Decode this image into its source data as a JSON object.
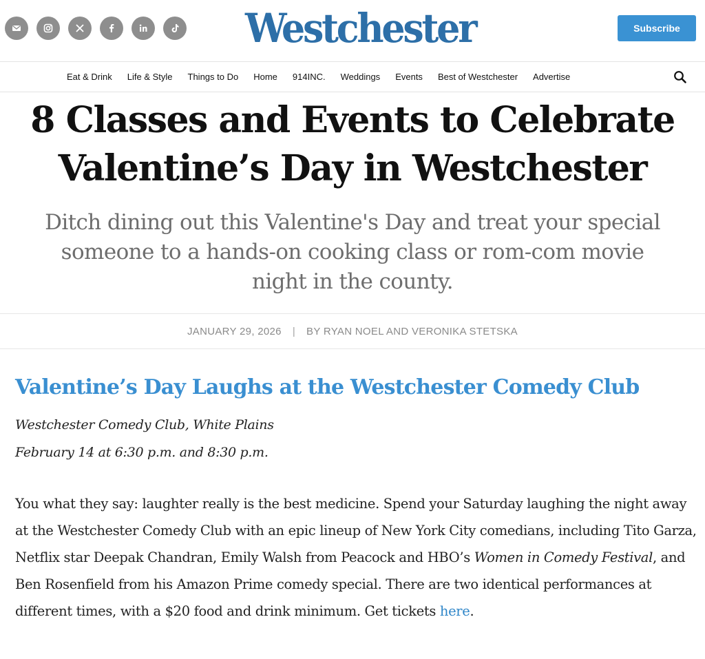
{
  "header": {
    "logo_text": "Westchester",
    "subscribe_label": "Subscribe",
    "social_icons": [
      "email-icon",
      "instagram-icon",
      "x-icon",
      "facebook-icon",
      "linkedin-icon",
      "tiktok-icon"
    ]
  },
  "nav": {
    "items": [
      "Eat & Drink",
      "Life & Style",
      "Things to Do",
      "Home",
      "914INC.",
      "Weddings",
      "Events",
      "Best of Westchester",
      "Advertise"
    ]
  },
  "article": {
    "headline_line1": "8 Classes and Events to Celebrate",
    "headline_line2": "Valentine’s Day in Westchester",
    "dek_line1": "Ditch dining out this Valentine's Day and treat your special",
    "dek_line2": "someone to a hands-on cooking class or rom-com movie",
    "dek_line3": "night in the county.",
    "date": "JANUARY 29, 2026",
    "separator": "|",
    "byline": "BY RYAN NOEL AND VERONIKA STETSKA"
  },
  "section": {
    "title": "Valentine’s Day Laughs at the Westchester Comedy Club",
    "location": "Westchester Comedy Club, White Plains",
    "date_time": "February 14 at 6:30 p.m. and 8:30 p.m.",
    "body_1": "You what they say: laughter really is the best medicine. Spend your Saturday laughing the night away at the Westchester Comedy Club with an epic lineup of New York City comedians, including Tito Garza, Netflix star Deepak Chandran, Emily Walsh from Peacock and HBO’s ",
    "body_italic": "Women in Comedy Festival",
    "body_2": ", and Ben Rosenfield from his Amazon Prime comedy special. There are two identical performances at different times, with a $20 food and drink minimum. Get tickets ",
    "link_text": "here",
    "body_end": "."
  },
  "colors": {
    "brand_blue": "#2d6fa8",
    "subscribe_bg": "#3a92d3",
    "link_blue": "#2f86c8",
    "social_gray": "#8e8e8e"
  }
}
